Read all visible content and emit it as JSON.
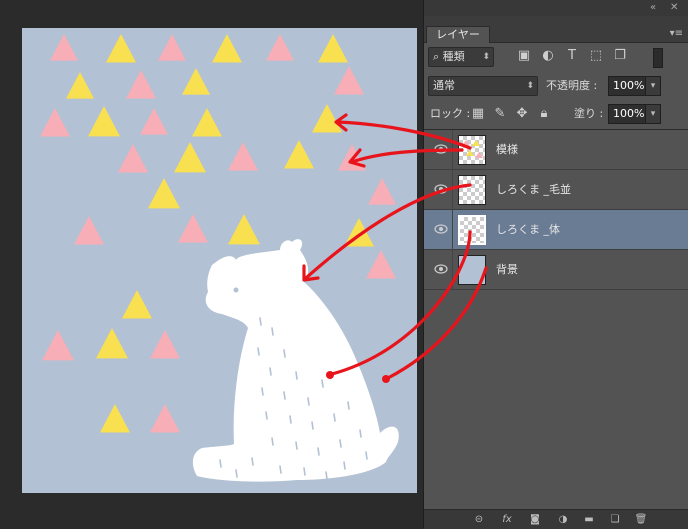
{
  "panel": {
    "tab_label": "レイヤー",
    "topbar": {
      "collapse_icon": "double-chevron-icon",
      "close_icon": "close-icon",
      "menu_icon": "panel-menu-icon"
    },
    "filter": {
      "kind_label": "種類"
    },
    "blend_mode": "通常",
    "opacity_label": "不透明度 :",
    "opacity_value": "100%",
    "lock_label": "ロック :",
    "fill_label": "塗り :",
    "fill_value": "100%"
  },
  "layers": [
    {
      "name": "模様",
      "visible": true,
      "selected": false
    },
    {
      "name": "しろくま _毛並",
      "visible": true,
      "selected": false
    },
    {
      "name": "しろくま _体",
      "visible": true,
      "selected": true
    },
    {
      "name": "背景",
      "visible": true,
      "selected": false
    }
  ],
  "bottom_icons": [
    "link-icon",
    "fx-icon",
    "mask-icon",
    "adjustment-icon",
    "folder-icon",
    "new-layer-icon",
    "trash-icon"
  ],
  "colors": {
    "canvas_bg": "#b2c1d3",
    "pink": "#f7aeb7",
    "yellow": "#f8e050",
    "bear": "#ffffff",
    "arrow": "#e8141c",
    "selected_layer": "#6a7b94"
  }
}
